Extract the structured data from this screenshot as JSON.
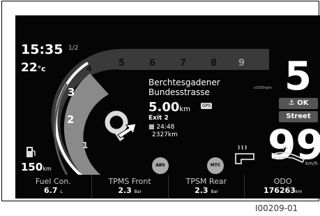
{
  "status": {
    "clock": "15:35",
    "fraction": "1/2",
    "temperature": "22",
    "temp_unit": "°c",
    "range_value": "150",
    "range_unit": "km"
  },
  "tachometer": {
    "rpm_marks": [
      "1",
      "2",
      "3",
      "4",
      "5",
      "6",
      "7",
      "8",
      "9"
    ],
    "unit": "x1000rpm"
  },
  "navigation": {
    "street_line1": "Berchtesgadener",
    "street_line2": "Bundesstrasse",
    "distance": "5.00",
    "distance_unit": "km",
    "gps_badge": "GPS",
    "exit": "Exit 2",
    "arrival_time": "24:48",
    "total_distance": "2327km"
  },
  "right_panel": {
    "gear": "5",
    "ok_label": "OK",
    "mode_label": "Street",
    "speed": "99",
    "speed_unit": "km/h"
  },
  "indicators": {
    "abs_label": "ABS",
    "abs_state": "ON",
    "mtc_label": "MTC",
    "mtc_state": "ON"
  },
  "bottom_bar": [
    {
      "label": "Fuel Con.",
      "value": "6.7",
      "unit": "L"
    },
    {
      "label": "TPMS Front",
      "value": "2.3",
      "unit": "Bar"
    },
    {
      "label": "TPSM Rear",
      "value": "2.3",
      "unit": "Bar"
    },
    {
      "label": "ODO",
      "value": "176263",
      "unit": "km"
    }
  ],
  "caption": "I00209-01"
}
